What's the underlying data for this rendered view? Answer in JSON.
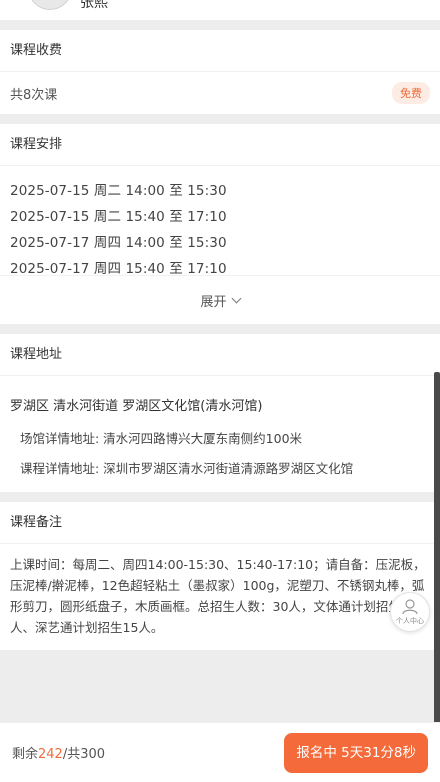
{
  "teacher": {
    "name": "张熙"
  },
  "fee": {
    "title": "课程收费",
    "lessons": "共8次课",
    "badge": "免费"
  },
  "schedule": {
    "title": "课程安排",
    "items": [
      "2025-07-15 周二 14:00 至 15:30",
      "2025-07-15 周二 15:40 至 17:10",
      "2025-07-17 周四 14:00 至 15:30",
      "2025-07-17 周四 15:40 至 17:10"
    ],
    "expand_label": "展开"
  },
  "address": {
    "title": "课程地址",
    "main": "罗湖区 清水河街道 罗湖区文化馆(清水河馆)",
    "venue": "场馆详情地址: 清水河四路博兴大厦东南侧约100米",
    "detail": "课程详情地址: 深圳市罗湖区清水河街道清源路罗湖区文化馆"
  },
  "notes": {
    "title": "课程备注",
    "text": "上课时间：每周二、周四14:00-15:30、15:40-17:10；请自备：压泥板，压泥棒/擀泥棒，12色超轻粘土（墨叔家）100g，泥塑刀、不锈钢丸棒，弧形剪刀，圆形纸盘子，木质画框。总招生人数：30人，文体通计划招生15人、深艺通计划招生15人。"
  },
  "float_button": {
    "label": "个人中心",
    "icon": "person-icon"
  },
  "footer": {
    "remain_prefix": "剩余",
    "remain_count": "242",
    "remain_total": "/共300",
    "button_label": "报名中 5天31分8秒"
  },
  "colors": {
    "accent": "#f56a3a",
    "badge_bg": "#fdece4",
    "page_bg": "#ededed"
  }
}
